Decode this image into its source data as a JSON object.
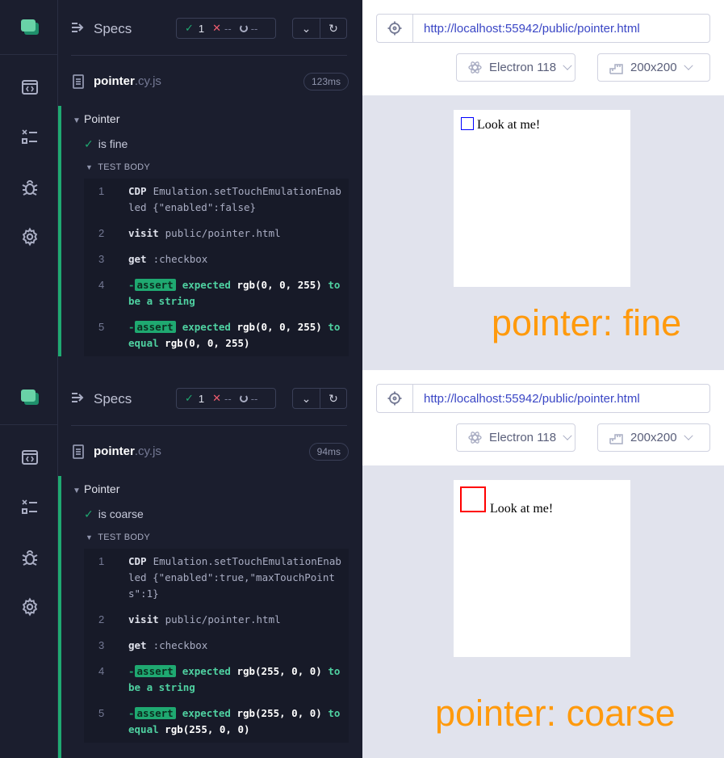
{
  "colors": {
    "pass": "#1fa971",
    "fail": "#f05d6f",
    "accent_orange": "#ff9a0d",
    "url_blue": "#3a46c5",
    "checkbox_fine": "#0000ff",
    "checkbox_coarse": "#ff0000"
  },
  "sidenav_icons": [
    "cypress-logo-icon",
    "runs-icon",
    "specs-list-icon",
    "debug-bug-icon",
    "settings-gear-icon"
  ],
  "runs": [
    {
      "header": {
        "specs_label": "Specs",
        "passed": "1",
        "failed": "--",
        "pending": "--"
      },
      "file": {
        "name": "pointer",
        "ext": ".cy.js",
        "duration": "123ms"
      },
      "suite": "Pointer",
      "test": "is fine",
      "test_body_label": "TEST BODY",
      "commands": [
        {
          "num": "1",
          "name": "CDP",
          "message": "Emulation.setTouchEmulationEnabled {\"enabled\":false}"
        },
        {
          "num": "2",
          "name": "visit",
          "message": "public/pointer.html"
        },
        {
          "num": "3",
          "name": "get",
          "message": ":checkbox"
        },
        {
          "num": "4",
          "assert": "assert",
          "expected": "expected",
          "value": "rgb(0, 0, 255)",
          "relation": "to be a string",
          "target": ""
        },
        {
          "num": "5",
          "assert": "assert",
          "expected": "expected",
          "value": "rgb(0, 0, 255)",
          "relation": "to equal",
          "target": "rgb(0, 0, 255)"
        }
      ],
      "url": "http://localhost:55942/public/pointer.html",
      "browser": "Electron 118",
      "viewport": "200x200",
      "aut_text": "Look at me!",
      "big_label": "pointer: fine"
    },
    {
      "header": {
        "specs_label": "Specs",
        "passed": "1",
        "failed": "--",
        "pending": "--"
      },
      "file": {
        "name": "pointer",
        "ext": ".cy.js",
        "duration": "94ms"
      },
      "suite": "Pointer",
      "test": "is coarse",
      "test_body_label": "TEST BODY",
      "commands": [
        {
          "num": "1",
          "name": "CDP",
          "message": "Emulation.setTouchEmulationEnabled {\"enabled\":true,\"maxTouchPoints\":1}"
        },
        {
          "num": "2",
          "name": "visit",
          "message": "public/pointer.html"
        },
        {
          "num": "3",
          "name": "get",
          "message": ":checkbox"
        },
        {
          "num": "4",
          "assert": "assert",
          "expected": "expected",
          "value": "rgb(255, 0, 0)",
          "relation": "to be a string",
          "target": ""
        },
        {
          "num": "5",
          "assert": "assert",
          "expected": "expected",
          "value": "rgb(255, 0, 0)",
          "relation": "to equal",
          "target": "rgb(255, 0, 0)"
        }
      ],
      "url": "http://localhost:55942/public/pointer.html",
      "browser": "Electron 118",
      "viewport": "200x200",
      "aut_text": "Look at me!",
      "big_label": "pointer: coarse"
    }
  ]
}
